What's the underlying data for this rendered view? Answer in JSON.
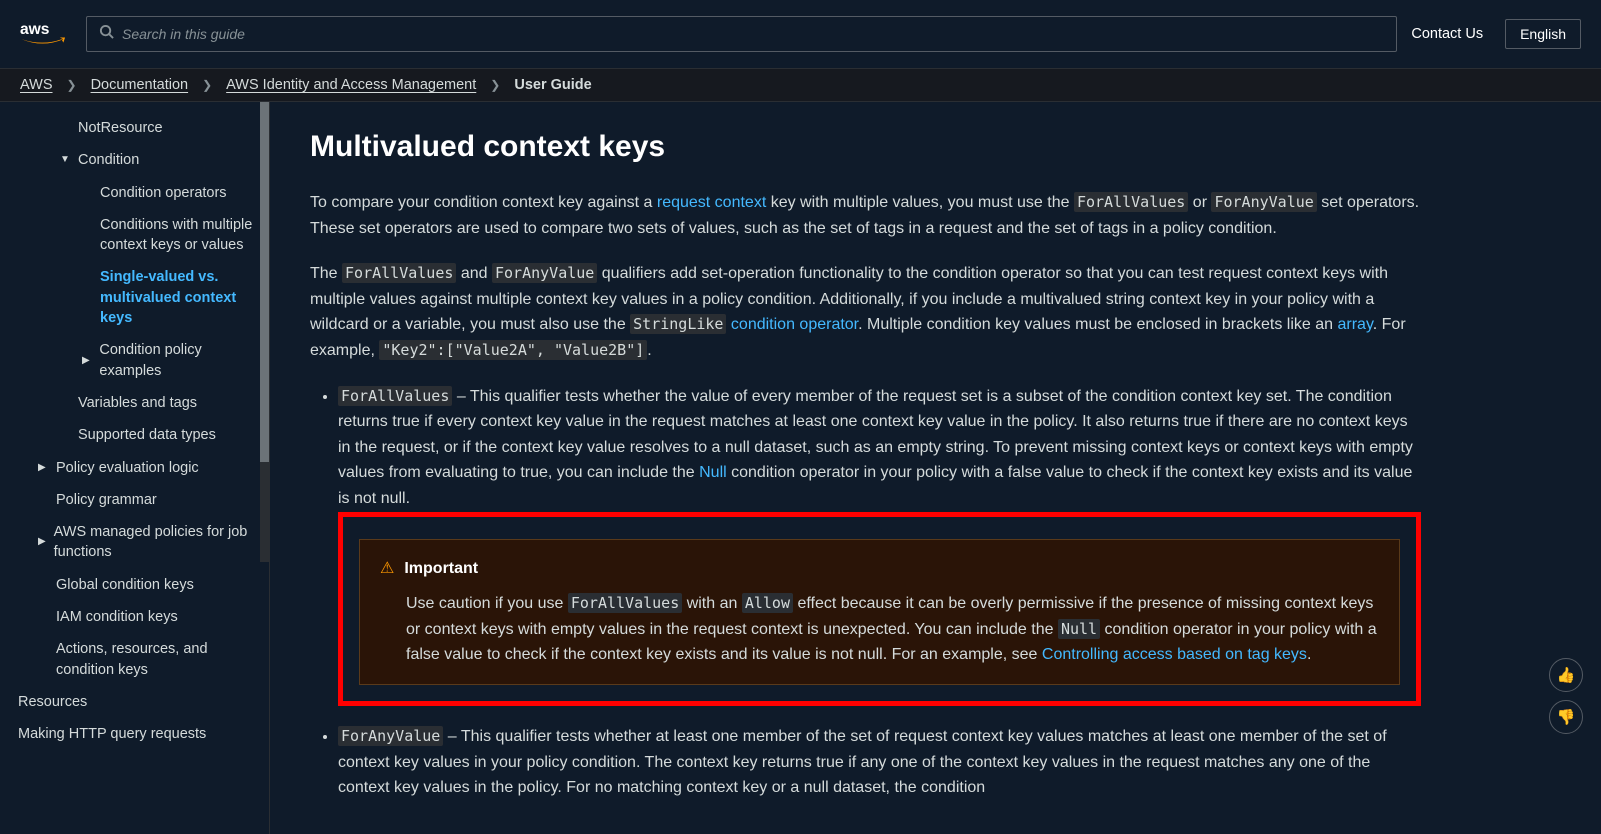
{
  "header": {
    "search_placeholder": "Search in this guide",
    "contact_label": "Contact Us",
    "language_label": "English"
  },
  "breadcrumbs": {
    "aws": "AWS",
    "docs": "Documentation",
    "service": "AWS Identity and Access Management",
    "current": "User Guide"
  },
  "sidebar": {
    "items": [
      {
        "label": "NotResource",
        "level": "l2"
      },
      {
        "label": "Condition",
        "level": "l2",
        "icon": "down"
      },
      {
        "label": "Condition operators",
        "level": "l3"
      },
      {
        "label": "Conditions with multiple context keys or values",
        "level": "l3"
      },
      {
        "label": "Single-valued vs. multivalued context keys",
        "level": "l3",
        "active": true
      },
      {
        "label": "Condition policy examples",
        "level": "l3",
        "icon": "right"
      },
      {
        "label": "Variables and tags",
        "level": "l2"
      },
      {
        "label": "Supported data types",
        "level": "l2"
      },
      {
        "label": "Policy evaluation logic",
        "level": "l1",
        "icon": "right"
      },
      {
        "label": "Policy grammar",
        "level": "l1"
      },
      {
        "label": "AWS managed policies for job functions",
        "level": "l1",
        "icon": "right"
      },
      {
        "label": "Global condition keys",
        "level": "l1"
      },
      {
        "label": "IAM condition keys",
        "level": "l1"
      },
      {
        "label": "Actions, resources, and condition keys",
        "level": "l1"
      },
      {
        "label": "Resources",
        "level": "l0"
      },
      {
        "label": "Making HTTP query requests",
        "level": "l0"
      }
    ]
  },
  "content": {
    "title": "Multivalued context keys",
    "p1a": "To compare your condition context key against a ",
    "p1_link1": "request context",
    "p1b": " key with multiple values, you must use the ",
    "p1_code1": "ForAllValues",
    "p1c": " or ",
    "p1_code2": "ForAnyValue",
    "p1d": " set operators. These set operators are used to compare two sets of values, such as the set of tags in a request and the set of tags in a policy condition.",
    "p2a": "The ",
    "p2_code1": "ForAllValues",
    "p2b": " and ",
    "p2_code2": "ForAnyValue",
    "p2c": " qualifiers add set-operation functionality to the condition operator so that you can test request context keys with multiple values against multiple context key values in a policy condition. Additionally, if you include a multivalued string context key in your policy with a wildcard or a variable, you must also use the ",
    "p2_code3": "StringLike",
    "p2d": " ",
    "p2_link1": "condition operator",
    "p2e": ". Multiple condition key values must be enclosed in brackets like an ",
    "p2_link2": "array",
    "p2f": ". For example, ",
    "p2_code4": "\"Key2\":[\"Value2A\", \"Value2B\"]",
    "p2g": ".",
    "q1_code": "ForAllValues",
    "q1a": " – This qualifier tests whether the value of every member of the request set is a subset of the condition context key set. The condition returns true if every context key value in the request matches at least one context key value in the policy. It also returns true if there are no context keys in the request, or if the context key value resolves to a null dataset, such as an empty string. To prevent missing context keys or context keys with empty values from evaluating to true, you can include the ",
    "q1_link1": "Null",
    "q1b": " condition operator in your policy with a false value to check if the context key exists and its value is not null.",
    "callout": {
      "label": "Important",
      "a": "Use caution if you use ",
      "c1": "ForAllValues",
      "b": " with an ",
      "c2": "Allow",
      "c": " effect because it can be overly permissive if the presence of missing context keys or context keys with empty values in the request context is unexpected. You can include the ",
      "c3": "Null",
      "d": " condition operator in your policy with a false value to check if the context key exists and its value is not null. For an example, see ",
      "link": "Controlling access based on tag keys",
      "e": "."
    },
    "q2_code": "ForAnyValue",
    "q2a": " – This qualifier tests whether at least one member of the set of request context key values matches at least one member of the set of context key values in your policy condition. The context key returns true if any one of the context key values in the request matches any one of the context key values in the policy. For no matching context key or a null dataset, the condition"
  }
}
